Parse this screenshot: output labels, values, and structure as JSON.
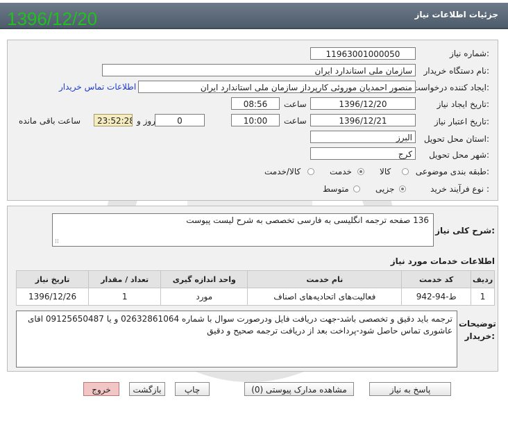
{
  "header": {
    "title": "جزئیات اطلاعات نیاز",
    "date": "1396/12/20"
  },
  "form": {
    "need_number_label": "شماره نیاز:",
    "need_number": "1196300100005‌0",
    "buyer_org_label": "نام دستگاه خریدار:",
    "buyer_org": "سازمان ملی استاندارد ایران",
    "creator_label": "ایجاد کننده درخواست:",
    "creator": "منصور احمدیان موروئی کارپرداز سازمان ملی استاندارد ایران",
    "contact_link": "اطلاعات تماس خریدار",
    "created_date_label": "تاریخ ایجاد نیاز:",
    "created_date": "1396/12/20",
    "created_time_label": "ساعت",
    "created_time": "08:56",
    "valid_date_label": "تاریخ اعتبار نیاز:",
    "valid_date": "1396/12/21",
    "valid_time_label": "ساعت",
    "valid_time": "10:00",
    "days": "0",
    "days_label": "روز و",
    "remaining": "23:52:28",
    "remaining_label": "ساعت باقی مانده",
    "province_label": "استان محل تحویل:",
    "province": "البرز",
    "city_label": "شهر محل تحویل:",
    "city": "کرج",
    "category_label": "طبقه بندی موضوعی:",
    "category_options": [
      "کالا",
      "خدمت",
      "کالا/خدمت"
    ],
    "process_label": "نوع فرآیند خرید :",
    "process_options": [
      "جزیی",
      "متوسط"
    ]
  },
  "description": {
    "label": "شرح کلی نیاز:",
    "text": "136 صفحه ترجمه انگلیسی به فارسی تخصصی به شرح لیست پیوست"
  },
  "services": {
    "title": "اطلاعات خدمات مورد نیاز",
    "headers": [
      "ردیف",
      "کد خدمت",
      "نام خدمت",
      "واحد اندازه گیری",
      "تعداد / مقدار",
      "تاریخ نیاز"
    ],
    "rows": [
      [
        "1",
        "ط-94-942",
        "فعالیت‌های اتحادیه‌های اصناف",
        "مورد",
        "1",
        "1396/12/26"
      ]
    ]
  },
  "notes": {
    "label": "توضیحات خریدار:",
    "text": "ترجمه باید دقیق و تخصصی باشد-جهت دریافت فایل ودرصورت سوال با شماره 02632861064 و یا 09125650487 اقای عاشوری تماس حاصل شود-پرداخت بعد از دریافت ترجمه صحیح و دقیق"
  },
  "buttons": {
    "reply": "پاسخ به نیاز",
    "attachments": "مشاهده مدارک پیوستی (0)",
    "print": "چاپ",
    "back": "بازگشت",
    "exit": "خروج"
  },
  "colors": {
    "date_green": "#20c020",
    "exit_bg": "#f3c6c6",
    "titlebar": "#5a6777"
  }
}
